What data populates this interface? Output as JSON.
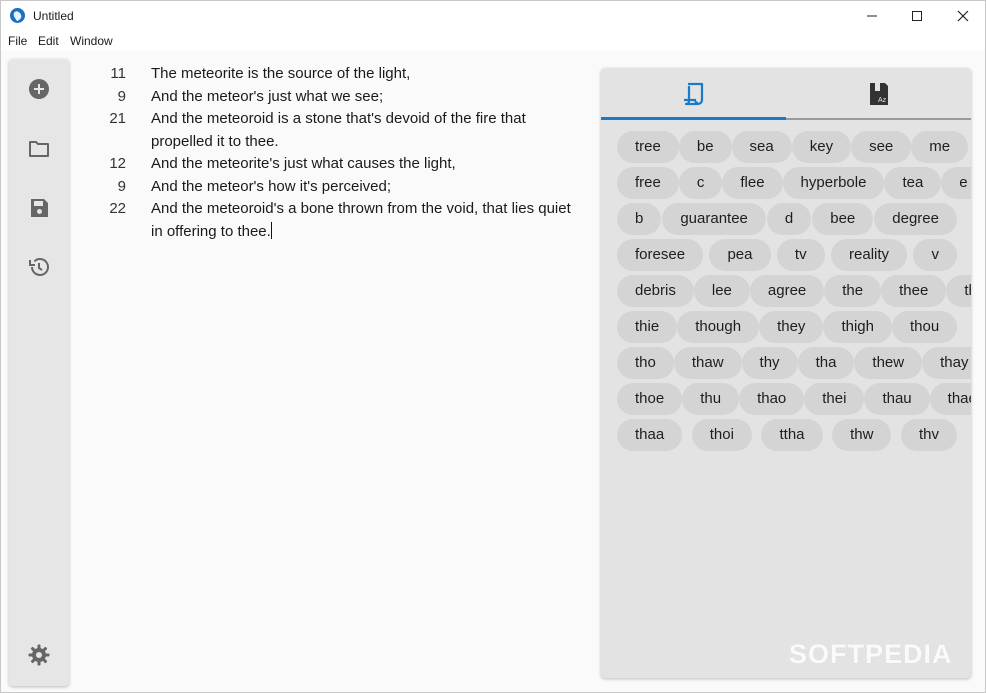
{
  "window": {
    "title": "Untitled"
  },
  "menu": [
    "File",
    "Edit",
    "Window"
  ],
  "sidebar": {
    "buttons": [
      "add-icon",
      "folder-icon",
      "save-icon",
      "history-icon"
    ],
    "bottom": "gear-icon"
  },
  "editor": {
    "lines": [
      {
        "count": "11",
        "text": "The meteorite is the source of the light,"
      },
      {
        "count": "9",
        "text": "And the meteor's just what we see;"
      },
      {
        "count": "21",
        "text": "And the meteoroid is a stone that's devoid of the fire that propelled it to thee."
      },
      {
        "count": "12",
        "text": "And the meteorite's just what causes the light,"
      },
      {
        "count": "9",
        "text": "And the meteor's how it's perceived;"
      },
      {
        "count": "22",
        "text": "And the meteoroid's a bone thrown from the void, that lies quiet in offering to thee."
      }
    ]
  },
  "panel": {
    "tabs": [
      "rhymes-icon",
      "dictionary-icon"
    ],
    "active_tab": 0,
    "accent": "#1a7ac8",
    "words": [
      [
        "tree",
        "be",
        "sea",
        "key",
        "see",
        "me"
      ],
      [
        "free",
        "c",
        "flee",
        "hyperbole",
        "tea",
        "e"
      ],
      [
        "b",
        "guarantee",
        "d",
        "bee",
        "degree"
      ],
      [
        "foresee",
        "pea",
        "tv",
        "reality",
        "v"
      ],
      [
        "debris",
        "lee",
        "agree",
        "the",
        "thee",
        "thi"
      ],
      [
        "thie",
        "though",
        "they",
        "thigh",
        "thou"
      ],
      [
        "tho",
        "thaw",
        "thy",
        "tha",
        "thew",
        "thay"
      ],
      [
        "thoe",
        "thu",
        "thao",
        "thei",
        "thau",
        "thae"
      ],
      [
        "thaa",
        "thoi",
        "ttha",
        "thw",
        "thv"
      ]
    ]
  },
  "watermark": "SOFTPEDIA"
}
